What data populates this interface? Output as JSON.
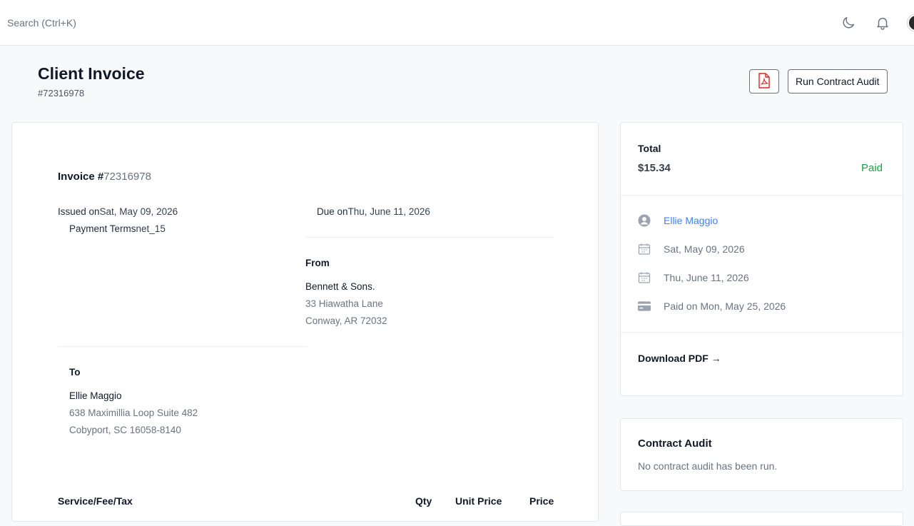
{
  "topbar": {
    "search_placeholder": "Search (Ctrl+K)",
    "icons": [
      "moon-icon",
      "bell-icon",
      "avatar"
    ]
  },
  "header": {
    "title": "Client Invoice",
    "subtitle": "#72316978",
    "pdf_icon": "pdf-file-icon",
    "audit_button": "Run Contract Audit"
  },
  "invoice": {
    "heading_prefix": "Invoice #",
    "heading_number": "72316978",
    "issued_label": "Issued on",
    "issued_value": "Sat, May 09, 2026",
    "due_label": "Due on",
    "due_value": "Thu, June 11, 2026",
    "terms_label": "Payment Terms",
    "terms_value": "net_15",
    "from": {
      "label": "From",
      "name": "Bennett & Sons.",
      "line1": "33 Hiawatha Lane",
      "line2": "Conway, AR 72032"
    },
    "to": {
      "label": "To",
      "name": "Ellie Maggio",
      "line1": "638 Maximillia Loop Suite 482",
      "line2": "Cobyport, SC 16058-8140"
    },
    "table_headers": {
      "service": "Service/Fee/Tax",
      "qty": "Qty",
      "unit_price": "Unit Price",
      "price": "Price"
    }
  },
  "summary": {
    "total_label": "Total",
    "total_amount": "$15.34",
    "status": "Paid",
    "status_color": "#16a34a",
    "client_name": "Ellie Maggio",
    "issued_date": "Sat, May 09, 2026",
    "due_date": "Thu, June 11, 2026",
    "paid_text": "Paid on Mon, May 25, 2026",
    "download_label": "Download PDF →"
  },
  "audit": {
    "title": "Contract Audit",
    "text": "No contract audit has been run."
  },
  "colors": {
    "accent_link": "#3b82f6",
    "pdf_red": "#dc2626"
  }
}
